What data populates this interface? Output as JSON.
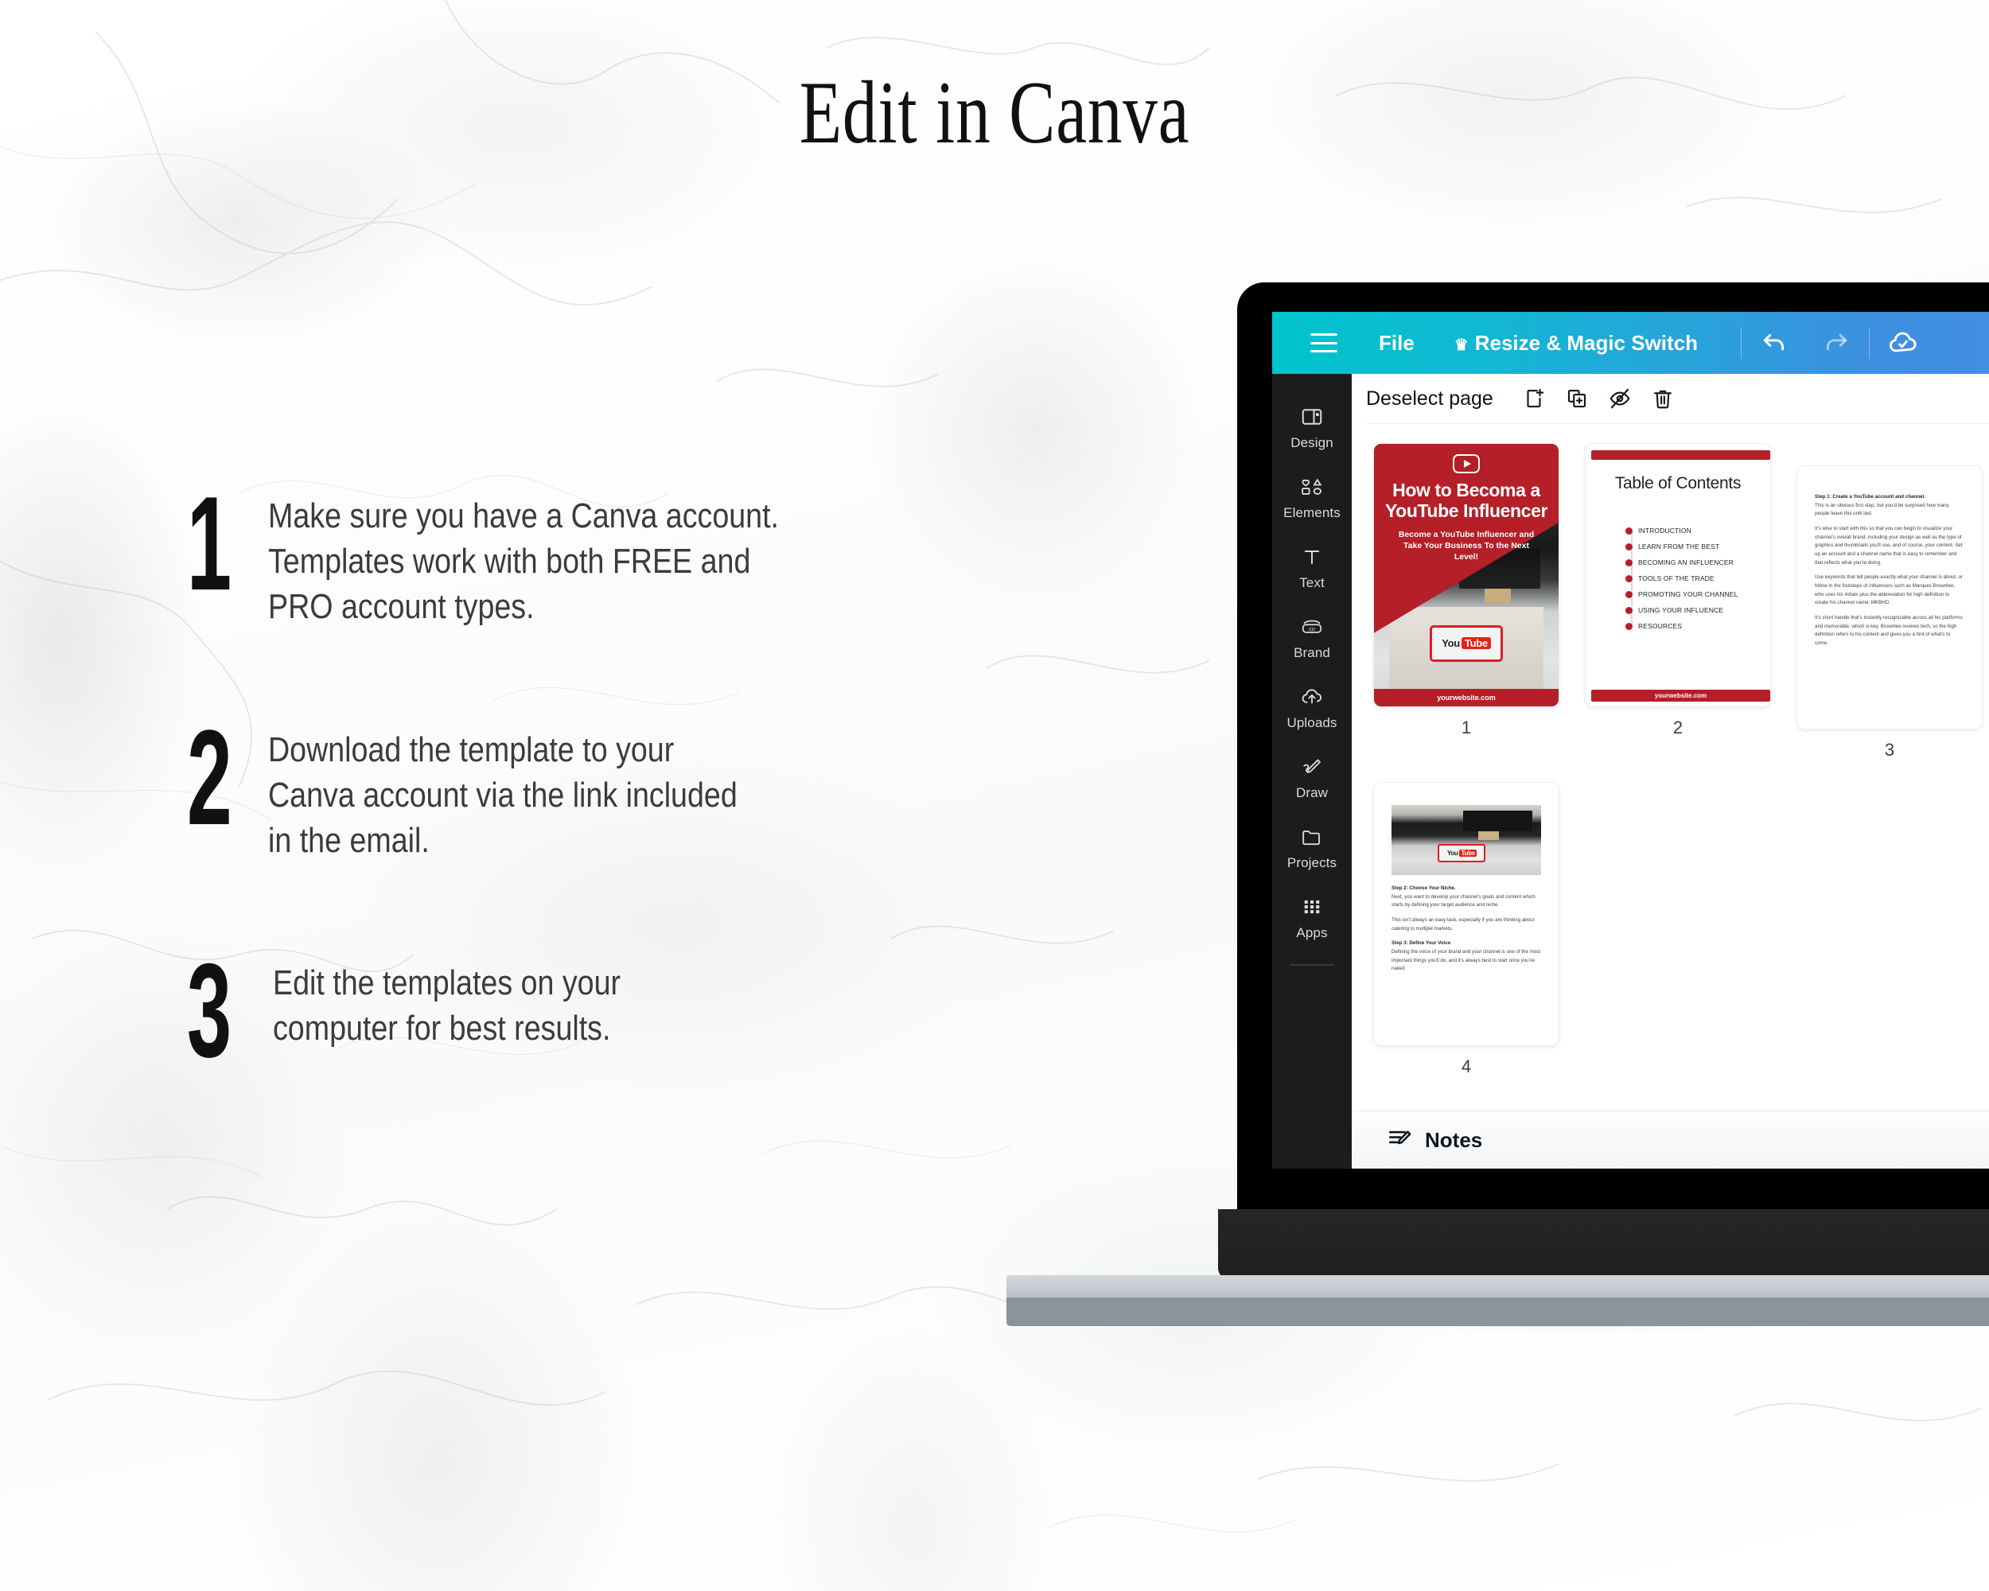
{
  "header": {
    "title": "Edit in Canva"
  },
  "steps": [
    {
      "number": "1",
      "text": "Make sure you have a Canva account.\nTemplates work with both FREE and\nPRO account types."
    },
    {
      "number": "2",
      "text": "Download the template to your\nCanva account via the link included\nin the email."
    },
    {
      "number": "3",
      "text": "Edit the templates on your\ncomputer for best results."
    }
  ],
  "app": {
    "topbar": {
      "menu_icon": "hamburger-icon",
      "file_label": "File",
      "resize_label": "Resize & Magic Switch",
      "crown_icon": "crown-icon",
      "undo_icon": "undo-icon",
      "redo_icon": "redo-icon",
      "cloud_icon": "cloud-check-icon"
    },
    "sidebar": [
      {
        "label": "Design",
        "icon": "design-icon"
      },
      {
        "label": "Elements",
        "icon": "elements-icon"
      },
      {
        "label": "Text",
        "icon": "text-icon"
      },
      {
        "label": "Brand",
        "icon": "brand-icon"
      },
      {
        "label": "Uploads",
        "icon": "uploads-icon"
      },
      {
        "label": "Draw",
        "icon": "draw-icon"
      },
      {
        "label": "Projects",
        "icon": "projects-icon"
      },
      {
        "label": "Apps",
        "icon": "apps-icon"
      }
    ],
    "workbar": {
      "deselect_label": "Deselect page",
      "add_page_icon": "add-page-icon",
      "duplicate_icon": "duplicate-page-icon",
      "hide_icon": "hide-page-icon",
      "delete_icon": "delete-page-icon"
    },
    "notes": {
      "label": "Notes",
      "icon": "notes-icon"
    },
    "pages": [
      {
        "number": "1",
        "type": "cover",
        "badge_icon": "youtube-play-icon",
        "title": "How to Becoma a\nYouTube Influencer",
        "subtitle": "Become a YouTube Influencer and Take Your\nBusiness To the Next Level!",
        "footer": "yourwebsite.com",
        "phone_logo": "You",
        "phone_logo_accent": "Tube"
      },
      {
        "number": "2",
        "type": "toc",
        "title": "Table of Contents",
        "items": [
          "INTRODUCTION",
          "LEARN FROM THE BEST",
          "BECOMING AN INFLUENCER",
          "TOOLS OF THE TRADE",
          "PROMOTING YOUR CHANNEL",
          "USING YOUR INFLUENCE",
          "RESOURCES"
        ],
        "footer": "yourwebsite.com"
      },
      {
        "number": "3",
        "type": "text",
        "paragraphs": [
          "Step 1: Create a YouTube account and channel.",
          "This is an obvious first step, but you'd be surprised how many people leave this until last.",
          "It's wise to start with this so that you can begin to visualize your channel's overall brand, including your design as well as the type of graphics and thumbnails you'll use, and of course, your content. Set up an account and a channel name that is easy to remember and that reflects what you're doing.",
          "Use keywords that tell people exactly what your channel is about, or follow in the footsteps of influencers such as Marques Brownlee, who uses his initials plus the abbreviation for high definition to create his channel name: MKBHD.",
          "It's short handle that's instantly recognizable across all his platforms and memorable, which is key. Brownlee reviews tech, so the high definition refers to his content and gives you a hint of what's to come."
        ]
      },
      {
        "number": "4",
        "type": "text-photo",
        "phone_logo": "You",
        "phone_logo_accent": "Tube",
        "paragraphs": [
          "Step 2: Choose Your Niche.",
          "Next, you want to develop your channel's goals and content which starts by defining your target audience and niche.",
          "This isn't always an easy task, especially if you are thinking about catering to multiple markets.",
          "Step 3: Define Your Voice",
          "Defining the voice of your brand and your channel is one of the most important things you'll do, and it's always best to start once you've nailed"
        ]
      }
    ]
  },
  "colors": {
    "canva_teal": "#00c4cc",
    "canva_blue": "#4a8fe4",
    "brand_red": "#b51f28",
    "sidebar_dark": "#1c1c1c"
  }
}
